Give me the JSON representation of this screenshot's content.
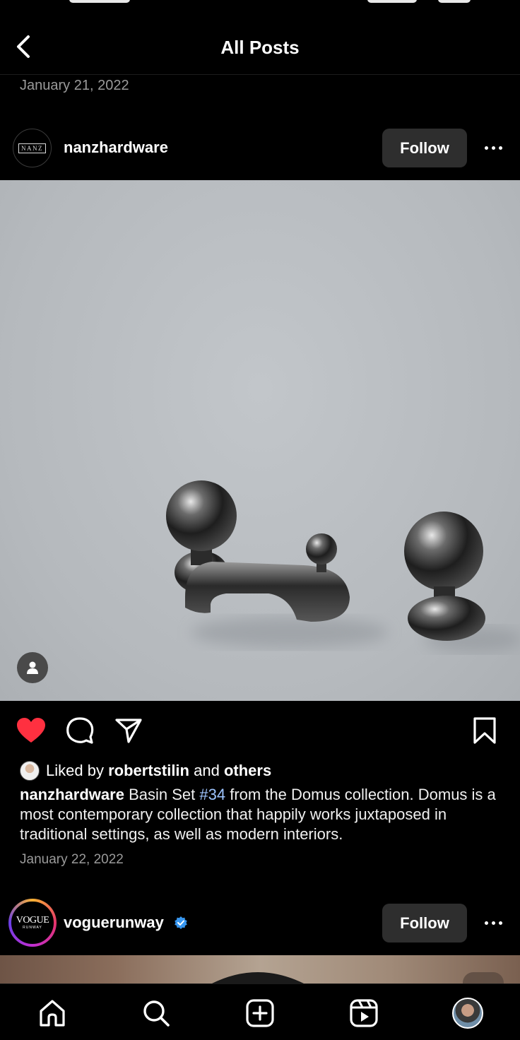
{
  "header": {
    "title": "All Posts"
  },
  "previous_post": {
    "date": "January 21, 2022"
  },
  "post": {
    "username": "nanzhardware",
    "avatar_text": "NANZ",
    "follow_label": "Follow",
    "liked_by_prefix": "Liked by",
    "liked_by_user": "robertstilin",
    "liked_by_and": "and",
    "liked_by_others": "others",
    "caption_user": "nanzhardware",
    "caption_before_tag": "Basin Set",
    "caption_tag": "#34",
    "caption_after_tag": "from the Domus collection. Domus is a most contemporary collection that happily works juxtaposed in traditional settings, as well as modern interiors.",
    "date": "January 22, 2022",
    "liked": true
  },
  "next_post": {
    "username": "voguerunway",
    "verified": true,
    "avatar_text_main": "VOGUE",
    "avatar_text_sub": "RUNWAY",
    "follow_label": "Follow"
  },
  "icons": {
    "back": "chevron-left-icon",
    "more": "more-horizontal-icon",
    "like": "heart-icon",
    "comment": "comment-icon",
    "share": "send-icon",
    "save": "bookmark-icon",
    "tag": "user-tag-icon",
    "verified": "verified-badge-icon"
  },
  "nav": [
    "home",
    "search",
    "create",
    "reels",
    "profile"
  ],
  "colors": {
    "like": "#ff3040",
    "verified": "#3897f0",
    "follow_bg": "#2e2e2e",
    "tag_link": "#9ec5ff"
  }
}
